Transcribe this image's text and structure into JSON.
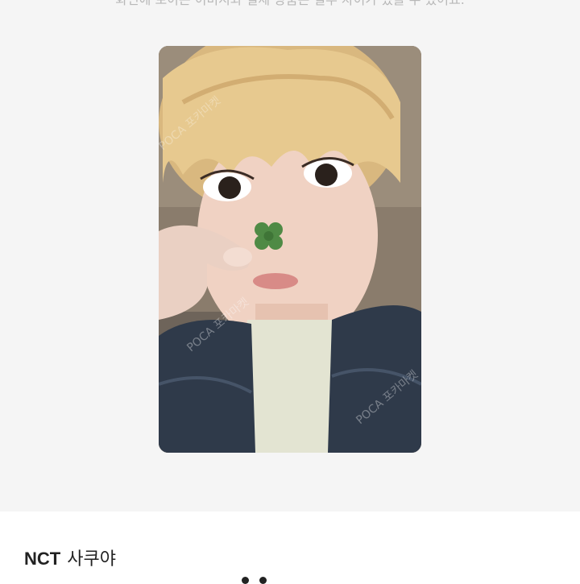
{
  "notice": {
    "text": "화면에 보이는 이미지와 실제 상품은 일부 차이가 있을 수 있어요."
  },
  "photocard": {
    "subject": "blonde person holding a four-leaf clover to their nose, wearing a denim jacket",
    "watermark": "POCA 포카마켓",
    "colors": {
      "background": "#f5f5f5",
      "jacket": "#2f3a4a",
      "hair": "#e7c98f",
      "clover": "#4f8a45"
    }
  },
  "product": {
    "group": "NCT",
    "member": "사쿠야"
  }
}
